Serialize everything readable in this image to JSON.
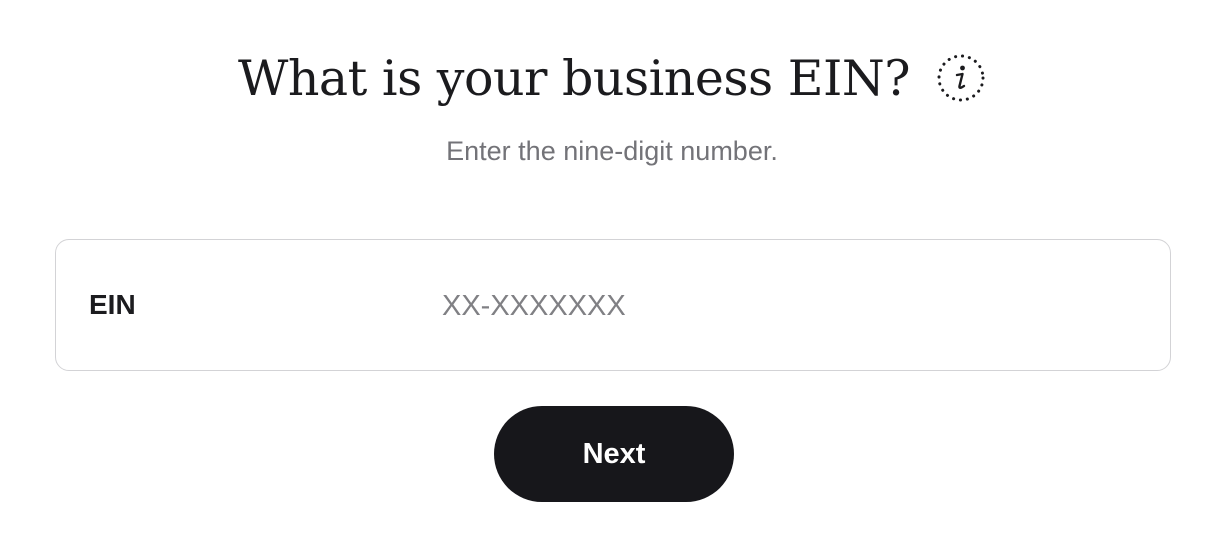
{
  "header": {
    "title": "What is your business EIN?",
    "info_icon": "info-icon",
    "subtitle": "Enter the nine-digit number."
  },
  "form": {
    "ein_label": "EIN",
    "ein_value": "",
    "ein_placeholder": "XX-XXXXXXX"
  },
  "actions": {
    "next_label": "Next"
  },
  "colors": {
    "primary": "#17171b",
    "subtitle": "#737378",
    "border": "#d3d3d6",
    "background": "#ffffff"
  }
}
